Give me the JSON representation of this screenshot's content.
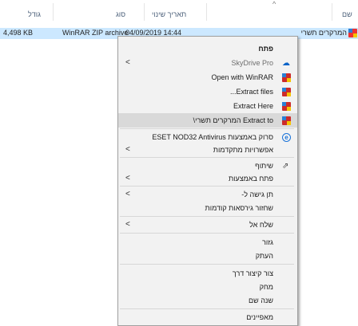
{
  "columns": {
    "name": "שם",
    "date": "תאריך שינוי",
    "type": "סוג",
    "size": "גודל"
  },
  "file": {
    "name": "המרקרים תשרי",
    "date": "04/09/2019 14:44",
    "type": "WinRAR ZIP archive",
    "size": "4,498 KB"
  },
  "menu": {
    "open": "פתח",
    "skydrive": "SkyDrive Pro",
    "open_winrar": "Open with WinRAR",
    "extract_files": "Extract files...",
    "extract_here": "Extract Here",
    "extract_to": "Extract to המרקרים תשרי\\",
    "eset_scan": "סרוק באמצעות ESET NOD32 Antivirus",
    "advanced": "אפשרויות מתקדמות",
    "share": "שיתוף",
    "open_with": "פתח באמצעות",
    "give_access": "תן גישה ל-",
    "restore": "שחזור גירסאות קודמות",
    "send_to": "שלח אל",
    "cut": "גזור",
    "copy": "העתק",
    "shortcut": "צור קיצור דרך",
    "delete": "מחק",
    "rename": "שנה שם",
    "properties": "מאפיינים"
  }
}
